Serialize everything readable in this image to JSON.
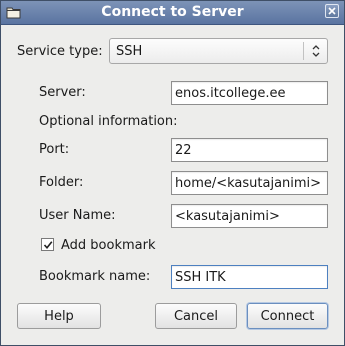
{
  "window": {
    "title": "Connect to Server"
  },
  "service": {
    "label": "Service type:",
    "selected": "SSH"
  },
  "server": {
    "label": "Server:",
    "value": "enos.itcollege.ee"
  },
  "optional": {
    "heading": "Optional information:"
  },
  "port": {
    "label": "Port:",
    "value": "22"
  },
  "folder": {
    "label": "Folder:",
    "value": "home/<kasutajanimi>"
  },
  "username": {
    "label": "User Name:",
    "value": "<kasutajanimi>"
  },
  "bookmark": {
    "checkbox_label": "Add bookmark",
    "checked": true,
    "name_label": "Bookmark name:",
    "name_value": "SSH ITK"
  },
  "buttons": {
    "help": "Help",
    "cancel": "Cancel",
    "connect": "Connect"
  }
}
